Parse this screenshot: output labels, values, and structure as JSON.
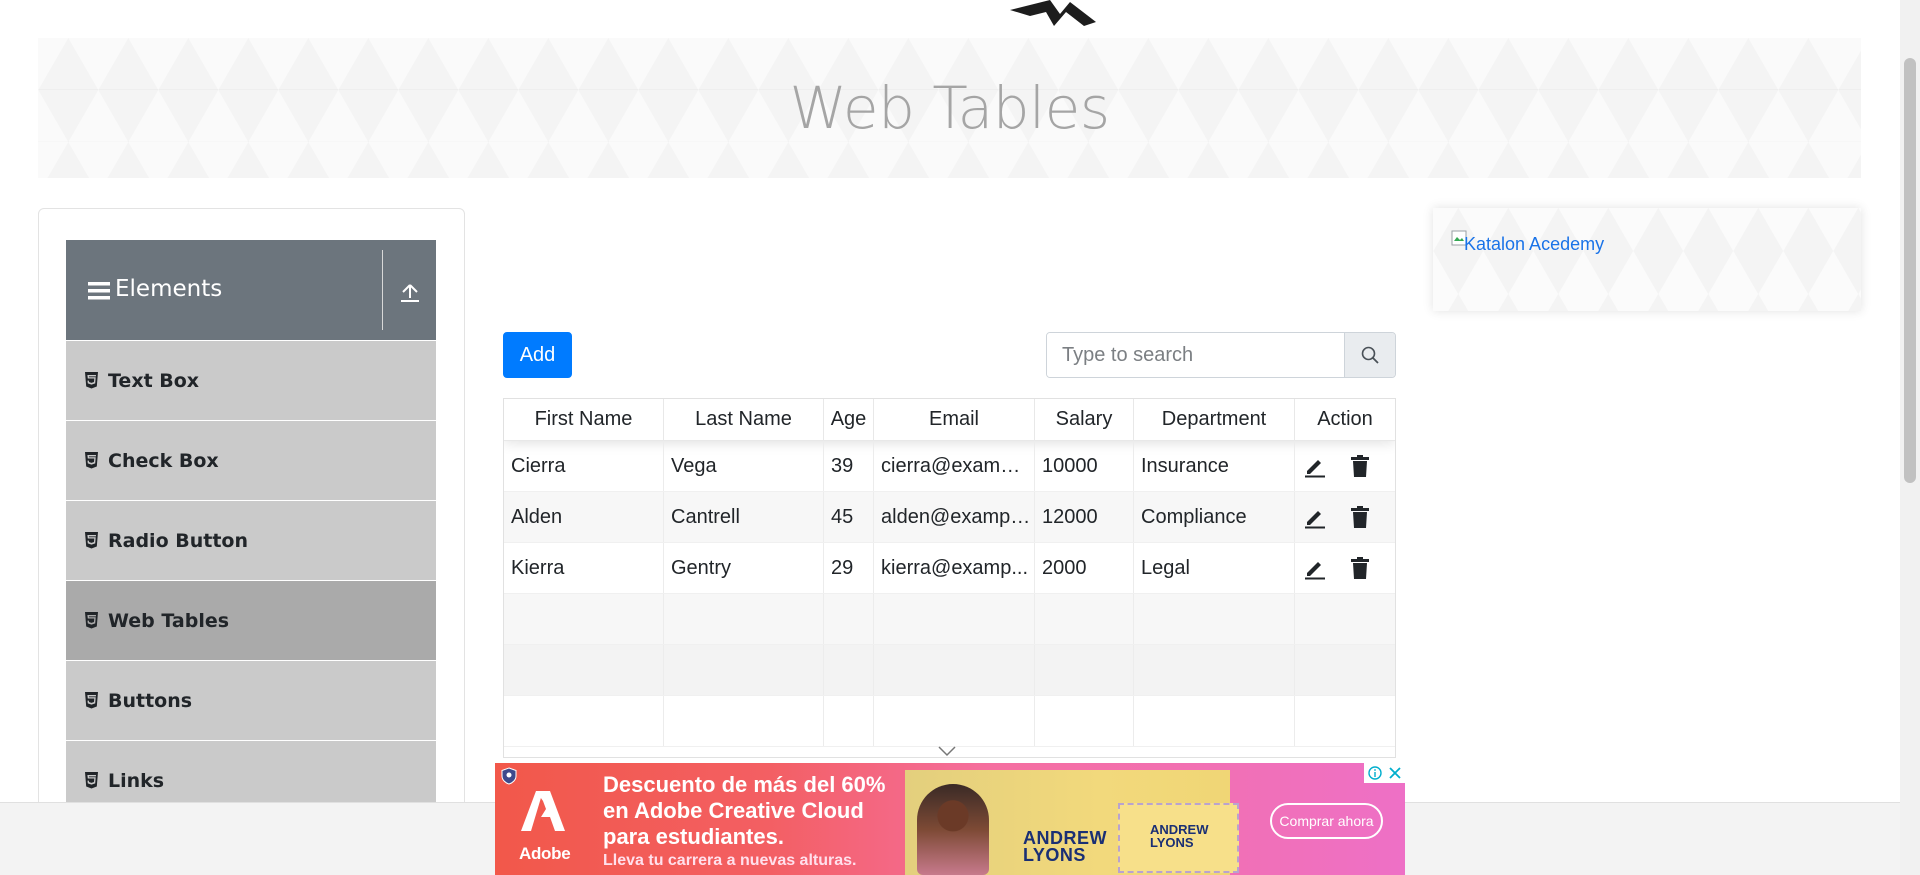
{
  "page": {
    "title": "Web Tables"
  },
  "sidebar": {
    "group_title": "Elements",
    "items": [
      {
        "label": "Text Box"
      },
      {
        "label": "Check Box"
      },
      {
        "label": "Radio Button"
      },
      {
        "label": "Web Tables",
        "active": true
      },
      {
        "label": "Buttons"
      },
      {
        "label": "Links"
      }
    ]
  },
  "toolbar": {
    "add_label": "Add",
    "search_placeholder": "Type to search"
  },
  "table": {
    "headers": [
      "First Name",
      "Last Name",
      "Age",
      "Email",
      "Salary",
      "Department",
      "Action"
    ],
    "rows": [
      {
        "first": "Cierra",
        "last": "Vega",
        "age": "39",
        "email": "cierra@exampl...",
        "salary": "10000",
        "department": "Insurance"
      },
      {
        "first": "Alden",
        "last": "Cantrell",
        "age": "45",
        "email": "alden@exampl...",
        "salary": "12000",
        "department": "Compliance"
      },
      {
        "first": "Kierra",
        "last": "Gentry",
        "age": "29",
        "email": "kierra@examp...",
        "salary": "2000",
        "department": "Legal"
      }
    ],
    "empty_rows": 3
  },
  "right_ad": {
    "alt_text": "Katalon Acedemy"
  },
  "bottom_ad": {
    "brand": "Adobe",
    "headline": "Descuento de más del 60% en Adobe Creative Cloud para estudiantes.",
    "subline": "Lleva tu carrera a nuevas alturas.",
    "person_name_line1": "ANDREW",
    "person_name_line2": "LYONS",
    "card_name_line1": "ANDREW",
    "card_name_line2": "LYONS",
    "cta": "Comprar ahora"
  },
  "colors": {
    "primary": "#007bff",
    "group_header": "#6c757d",
    "menu_item": "#cacaca",
    "menu_item_active": "#aaaaaa",
    "banner_title": "#a5a5a5"
  },
  "icons": {
    "menu": "hamburger-icon",
    "collapse": "upload-arrow-icon",
    "menu_item": "html5-icon",
    "search": "search-icon",
    "edit": "pencil-icon",
    "delete": "trash-icon"
  }
}
